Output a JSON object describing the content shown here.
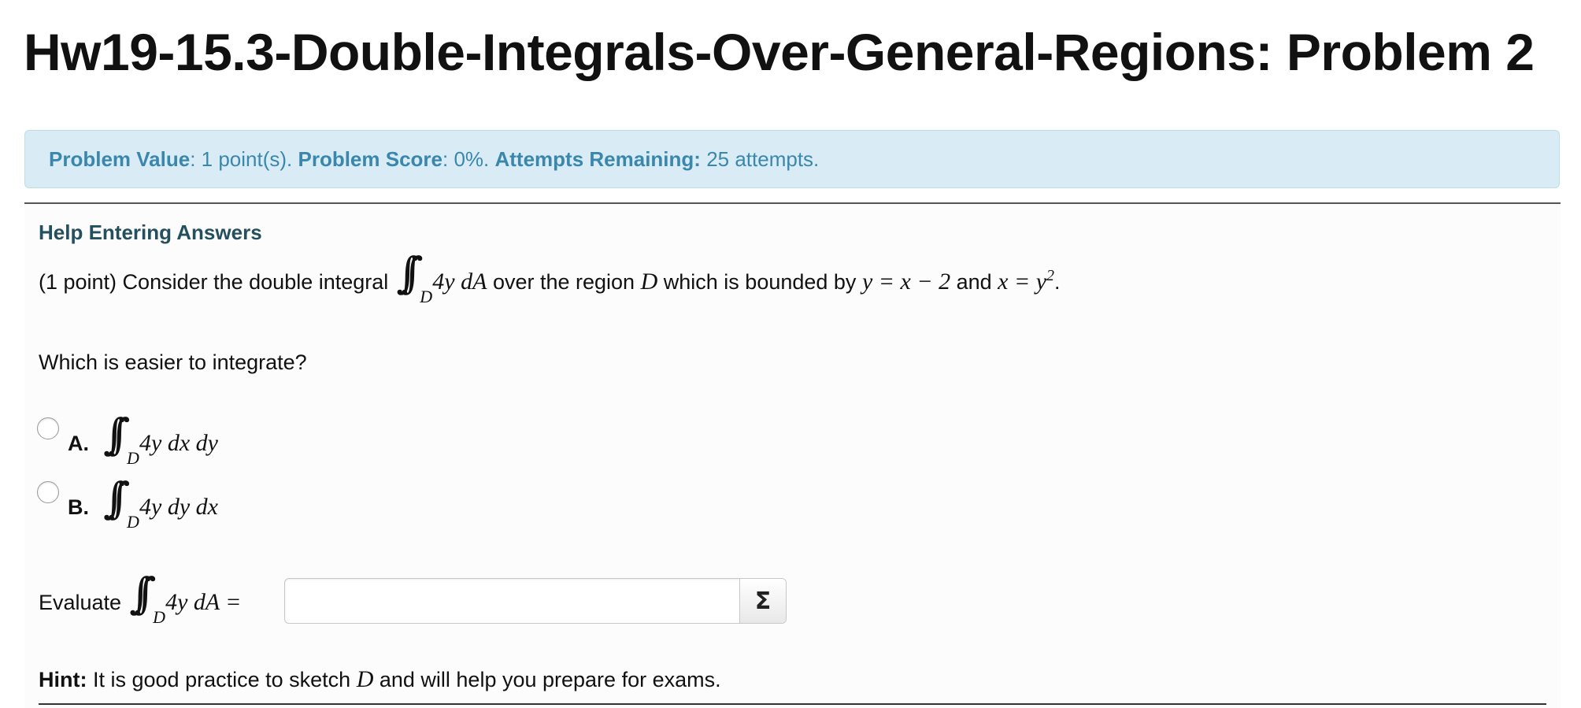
{
  "page": {
    "title": "Hw19-15.3-Double-Integrals-Over-General-Regions: Problem 2"
  },
  "info": {
    "value_label": "Problem Value",
    "value_text": ": 1 point(s).",
    "score_label": "Problem Score",
    "score_text": ": 0%.",
    "attempts_label": "Attempts Remaining:",
    "attempts_text": "25 attempts."
  },
  "problem": {
    "help_link": "Help Entering Answers",
    "intro": "(1 point) Consider the double integral",
    "integrand": "4y dA",
    "region_text": "over the region",
    "region_var": "D",
    "bounded_text": "which is bounded by",
    "eq1": "y = x − 2",
    "and_text": "and",
    "eq2_lhs": "x = y",
    "eq2_exp": "2",
    "period": ".",
    "sub": "D",
    "question": "Which is easier to integrate?",
    "options": [
      {
        "label": "A.",
        "integrand": "4y dx dy",
        "checked": false
      },
      {
        "label": "B.",
        "integrand": "4y dy dx",
        "checked": false
      }
    ],
    "evaluate_text": "Evaluate",
    "evaluate_integrand": "4y dA =",
    "answer_value": "",
    "sigma_label": "Σ",
    "hint_label": "Hint:",
    "hint_pre": "It is good practice to sketch",
    "hint_var": "D",
    "hint_post": "and will help you prepare for exams."
  }
}
